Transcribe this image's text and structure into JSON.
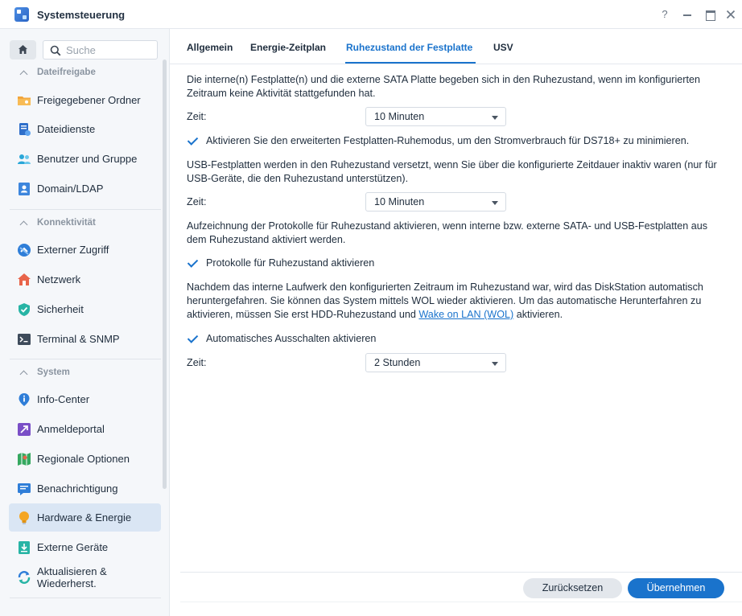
{
  "window": {
    "title": "Systemsteuerung",
    "help": "?"
  },
  "search": {
    "placeholder": "Suche"
  },
  "sidebar": {
    "sections": [
      {
        "label": "Dateifreigabe"
      },
      {
        "label": "Konnektivität"
      },
      {
        "label": "System"
      }
    ],
    "items": [
      {
        "label": "Freigegebener Ordner",
        "icon": "folder-share-icon"
      },
      {
        "label": "Dateidienste",
        "icon": "file-services-icon"
      },
      {
        "label": "Benutzer und Gruppe",
        "icon": "users-icon"
      },
      {
        "label": "Domain/LDAP",
        "icon": "domain-icon"
      },
      {
        "label": "Externer Zugriff",
        "icon": "external-access-icon"
      },
      {
        "label": "Netzwerk",
        "icon": "network-house-icon"
      },
      {
        "label": "Sicherheit",
        "icon": "shield-icon"
      },
      {
        "label": "Terminal & SNMP",
        "icon": "terminal-icon"
      },
      {
        "label": "Info-Center",
        "icon": "info-icon"
      },
      {
        "label": "Anmeldeportal",
        "icon": "login-portal-icon"
      },
      {
        "label": "Regionale Optionen",
        "icon": "map-icon"
      },
      {
        "label": "Benachrichtigung",
        "icon": "notification-icon"
      },
      {
        "label": "Hardware & Energie",
        "icon": "lightbulb-icon"
      },
      {
        "label": "Externe Geräte",
        "icon": "external-device-icon"
      },
      {
        "label": "Aktualisieren & Wiederherst.",
        "icon": "update-restore-icon"
      }
    ]
  },
  "tabs": [
    {
      "label": "Allgemein"
    },
    {
      "label": "Energie-Zeitplan"
    },
    {
      "label": "Ruhezustand der Festplatte",
      "active": true
    },
    {
      "label": "USV"
    }
  ],
  "content": {
    "para1": "Die interne(n) Festplatte(n) und die externe SATA Platte begeben sich in den Ruhezustand, wenn im konfigurierten Zeitraum keine Aktivität stattgefunden hat.",
    "time_label": "Zeit:",
    "time1_value": "10 Minuten",
    "check1_label": "Aktivieren Sie den erweiterten Festplatten-Ruhemodus, um den Stromverbrauch für DS718+ zu minimieren.",
    "check1_checked": true,
    "para2": "USB-Festplatten werden in den Ruhezustand versetzt, wenn Sie über die konfigurierte Zeitdauer inaktiv waren (nur für USB-Geräte, die den Ruhezustand unterstützen).",
    "time2_value": "10 Minuten",
    "para3": "Aufzeichnung der Protokolle für Ruhezustand aktivieren, wenn interne bzw. externe SATA- und USB-Festplatten aus dem Ruhezustand aktiviert werden.",
    "check2_label": "Protokolle für Ruhezustand aktivieren",
    "check2_checked": true,
    "para4_text": "Nachdem das interne Laufwerk den konfigurierten Zeitraum im Ruhezustand war, wird das DiskStation automatisch heruntergefahren. Sie können das System mittels WOL wieder aktivieren. Um das automatische Herunterfahren zu aktivieren, müssen Sie erst HDD-Ruhezustand und ",
    "para4_link": "Wake on LAN (WOL)",
    "para4_tail": " aktivieren.",
    "check3_label": "Automatisches Ausschalten aktivieren",
    "check3_checked": true,
    "time3_value": "2 Stunden"
  },
  "footer": {
    "reset_label": "Zurücksetzen",
    "apply_label": "Übernehmen"
  },
  "colors": {
    "accent": "#1a73cc",
    "sidebar_bg": "#f5f7fa",
    "active_item_bg": "#dae6f4"
  }
}
